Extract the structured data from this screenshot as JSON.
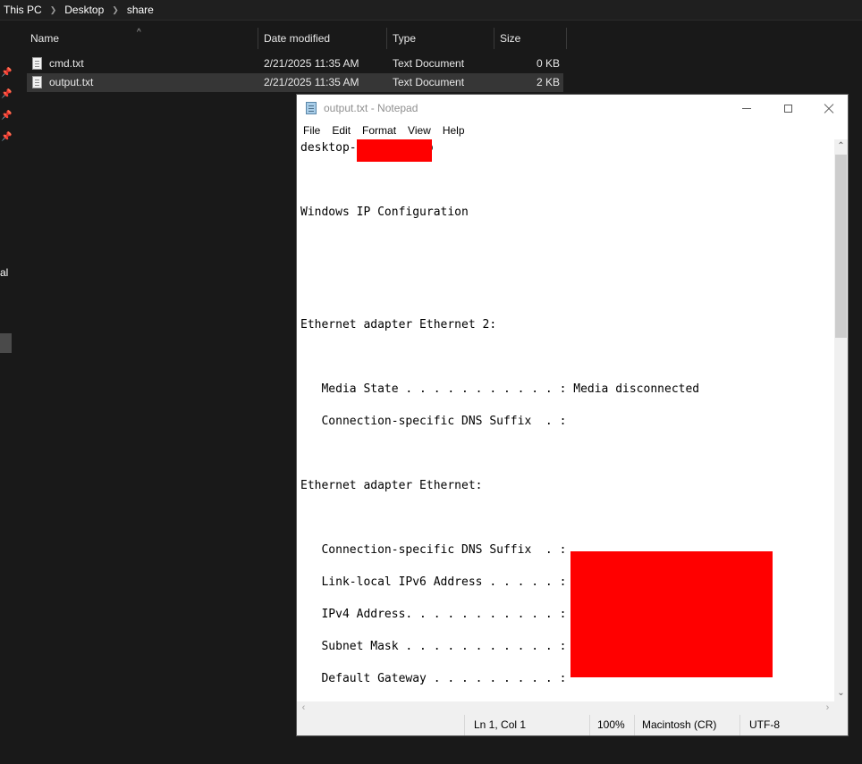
{
  "explorer": {
    "breadcrumb": [
      "This PC",
      "Desktop",
      "share"
    ],
    "nav_partial_label": "al",
    "columns": {
      "name": "Name",
      "date": "Date modified",
      "type": "Type",
      "size": "Size"
    },
    "files": [
      {
        "name": "cmd.txt",
        "date": "2/21/2025 11:35 AM",
        "type": "Text Document",
        "size": "0 KB"
      },
      {
        "name": "output.txt",
        "date": "2/21/2025 11:35 AM",
        "type": "Text Document",
        "size": "2 KB"
      }
    ]
  },
  "notepad": {
    "title": "output.txt - Notepad",
    "menu": [
      "File",
      "Edit",
      "Format",
      "View",
      "Help"
    ],
    "content": "desktop-          o\n\n\n\nWindows IP Configuration\n\n\n\n\n\n\nEthernet adapter Ethernet 2:\n\n\n\n   Media State . . . . . . . . . . . : Media disconnected\n\n   Connection-specific DNS Suffix  . :\n\n\n\nEthernet adapter Ethernet:\n\n\n\n   Connection-specific DNS Suffix  . :\n\n   Link-local IPv6 Address . . . . . :\n\n   IPv4 Address. . . . . . . . . . . :\n\n   Subnet Mask . . . . . . . . . . . :\n\n   Default Gateway . . . . . . . . . :",
    "status": {
      "position": "Ln 1, Col 1",
      "zoom": "100%",
      "line_ending": "Macintosh (CR)",
      "encoding": "UTF-8"
    }
  }
}
